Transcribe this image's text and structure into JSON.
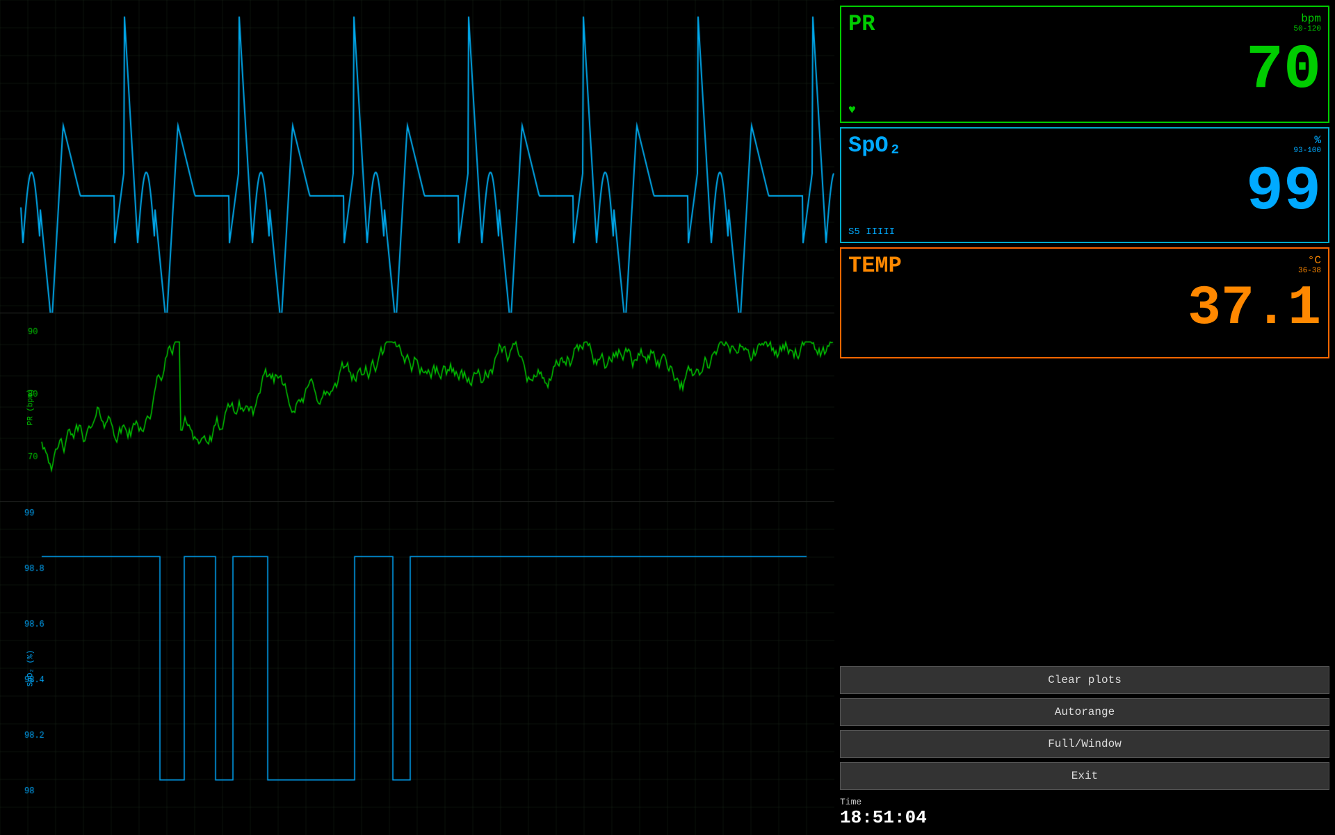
{
  "vitals": {
    "pr": {
      "label": "PR",
      "unit": "bpm",
      "range": "50-120",
      "value": "70",
      "color": "#00cc00"
    },
    "spo2": {
      "label": "SpO₂",
      "unit": "%",
      "range": "93-100",
      "value": "99",
      "extra": "S5 IIIII",
      "color": "#00aaff"
    },
    "temp": {
      "label": "TEMP",
      "unit": "°C",
      "range": "36-38",
      "value": "37.1",
      "color": "#ff8800"
    }
  },
  "controls": {
    "clear_plots": "Clear plots",
    "autorange": "Autorange",
    "full_window": "Full/Window",
    "exit": "Exit",
    "time_label": "Time",
    "time_value": "18:51:04"
  },
  "charts": {
    "pr_y_label": "PR (bpm)",
    "spo2_y_label": "SpO₂ (%)",
    "pr_y_ticks": [
      "90",
      "80",
      "70"
    ],
    "spo2_y_ticks": [
      "99",
      "98.8",
      "98.6",
      "98.4",
      "98.2",
      "98"
    ]
  }
}
